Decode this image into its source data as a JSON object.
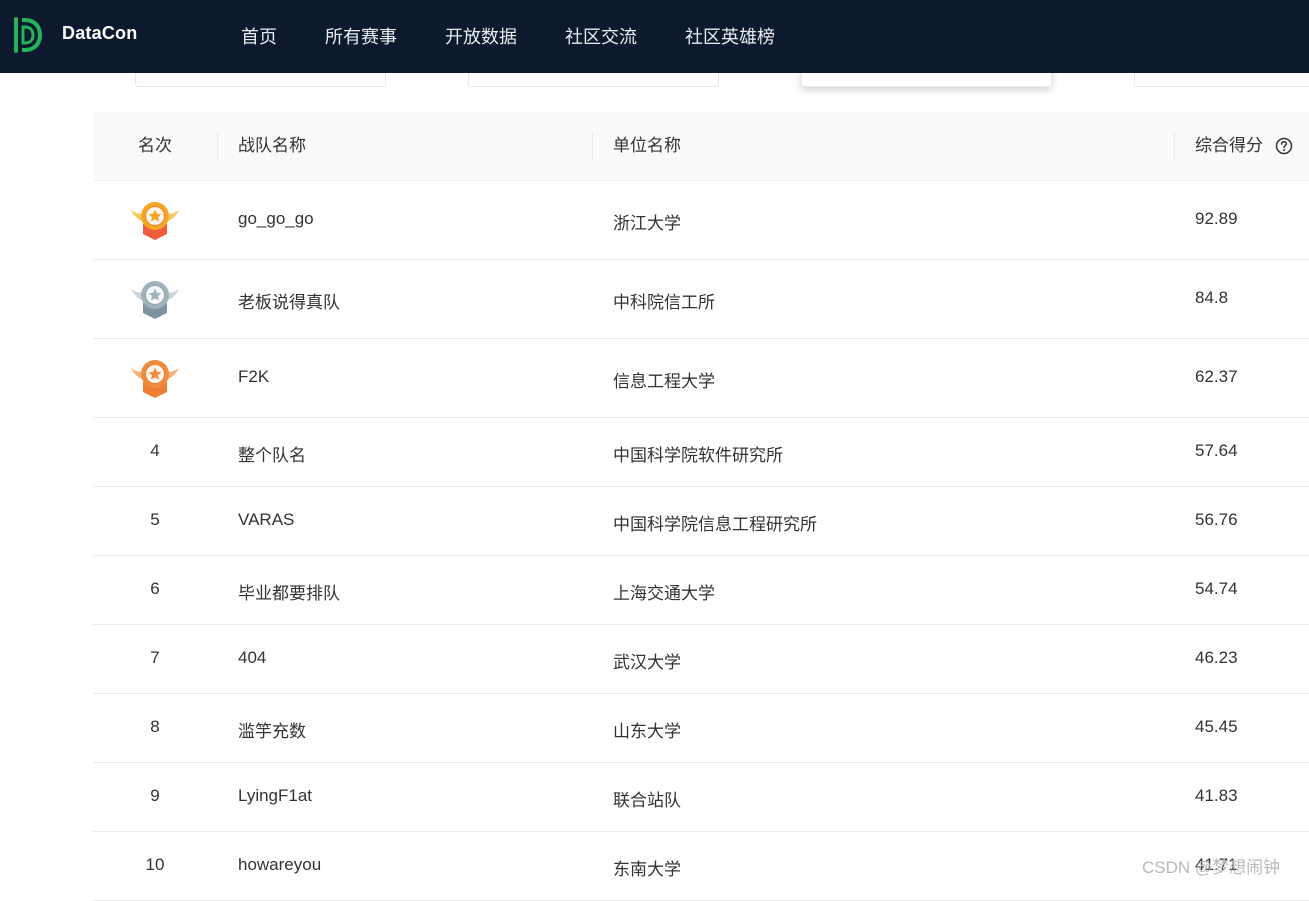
{
  "brand": {
    "name": "DataCon",
    "logo_icon": "datacon-logo-icon",
    "logo_color": "#23b45a"
  },
  "nav": [
    {
      "label": "首页"
    },
    {
      "label": "所有赛事"
    },
    {
      "label": "开放数据"
    },
    {
      "label": "社区交流"
    },
    {
      "label": "社区英雄榜"
    }
  ],
  "colors": {
    "navbar_bg": "#0d1a2d",
    "gold": "#f5a623",
    "silver": "#9fb3bd",
    "bronze": "#f08a3c"
  },
  "table": {
    "headers": {
      "rank": "名次",
      "team": "战队名称",
      "org": "单位名称",
      "score": "综合得分",
      "score_help_icon": "question-circle-icon"
    },
    "rows": [
      {
        "rank": "1",
        "medal": "gold",
        "team": "go_go_go",
        "org": "浙江大学",
        "score": "92.89"
      },
      {
        "rank": "2",
        "medal": "silver",
        "team": "老板说得真队",
        "org": "中科院信工所",
        "score": "84.8"
      },
      {
        "rank": "3",
        "medal": "bronze",
        "team": "F2K",
        "org": "信息工程大学",
        "score": "62.37"
      },
      {
        "rank": "4",
        "medal": null,
        "team": "整个队名",
        "org": "中国科学院软件研究所",
        "score": "57.64"
      },
      {
        "rank": "5",
        "medal": null,
        "team": "VARAS",
        "org": "中国科学院信息工程研究所",
        "score": "56.76"
      },
      {
        "rank": "6",
        "medal": null,
        "team": "毕业都要排队",
        "org": "上海交通大学",
        "score": "54.74"
      },
      {
        "rank": "7",
        "medal": null,
        "team": "404",
        "org": "武汉大学",
        "score": "46.23"
      },
      {
        "rank": "8",
        "medal": null,
        "team": "滥竽充数",
        "org": "山东大学",
        "score": "45.45"
      },
      {
        "rank": "9",
        "medal": null,
        "team": "LyingF1at",
        "org": "联合站队",
        "score": "41.83"
      },
      {
        "rank": "10",
        "medal": null,
        "team": "howareyou",
        "org": "东南大学",
        "score": "41.71"
      }
    ]
  },
  "watermark": "CSDN @梦想闹钟"
}
